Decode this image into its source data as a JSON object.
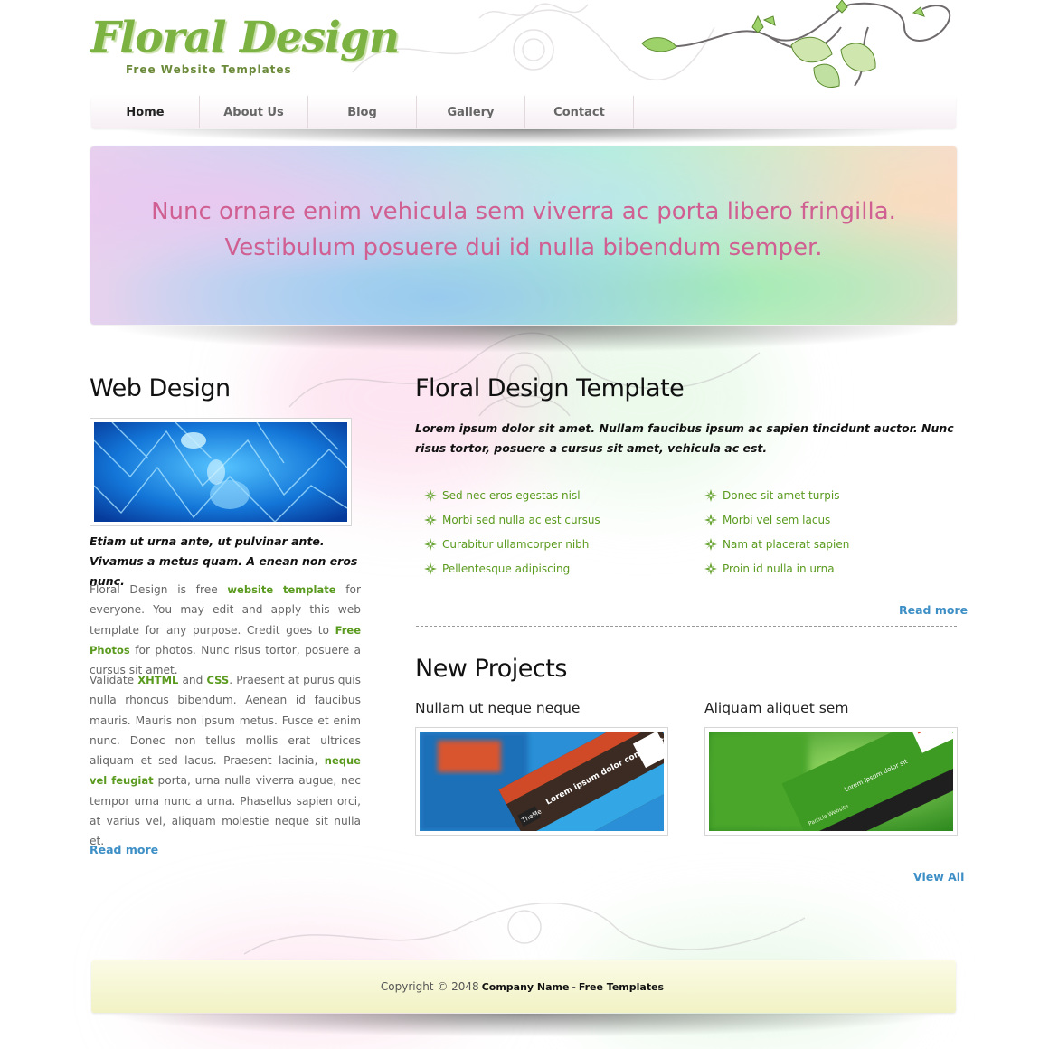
{
  "site": {
    "logo_title": "Floral Design",
    "logo_subtitle": "Free Website Templates"
  },
  "nav": {
    "items": [
      {
        "label": "Home",
        "active": true
      },
      {
        "label": "About Us"
      },
      {
        "label": "Blog"
      },
      {
        "label": "Gallery"
      },
      {
        "label": "Contact"
      }
    ]
  },
  "banner": {
    "line1": "Nunc ornare enim vehicula sem viverra ac porta libero fringilla.",
    "line2": "Vestibulum posuere dui id nulla bibendum semper."
  },
  "sidebar": {
    "heading": "Web Design",
    "lead": "Etiam ut urna ante, ut pulvinar ante. Vivamus a metus quam. A enean non eros nunc.",
    "p1_a": "Floral Design is free ",
    "p1_link1": "website template",
    "p1_b": " for everyone. You may edit and apply this web template for any purpose. Credit goes to ",
    "p1_link2": "Free Photos",
    "p1_c": " for photos. Nunc risus tortor, posuere a cursus sit amet.",
    "p2_a": "Validate ",
    "p2_link1": "XHTML",
    "p2_b": " and ",
    "p2_link2": "CSS",
    "p2_c": ". Praesent at purus quis nulla rhoncus bibendum. Aenean id faucibus mauris. Mauris non ipsum metus. Fusce et enim nunc. Donec non tellus mollis erat ultrices aliquam et sed lacus. Praesent lacinia, ",
    "p2_link3": "neque vel feugiat",
    "p2_d": " porta, urna nulla viverra augue, nec tempor urna nunc a urna. Phasellus sapien orci, at varius vel, aliquam molestie neque sit nulla et.",
    "read_more": "Read more"
  },
  "main": {
    "heading": "Floral Design Template",
    "lead": "Lorem ipsum dolor sit amet. Nullam faucibus ipsum ac sapien tincidunt auctor. Nunc risus tortor, posuere a cursus sit amet, vehicula ac est.",
    "list_left": [
      "Sed nec eros egestas nisl",
      "Morbi sed nulla ac est cursus",
      "Curabitur ullamcorper nibh",
      "Pellentesque adipiscing"
    ],
    "list_right": [
      "Donec sit amet turpis",
      "Morbi vel sem lacus",
      "Nam at placerat sapien",
      "Proin id nulla in urna"
    ],
    "read_more": "Read more"
  },
  "projects": {
    "heading": "New Projects",
    "items": [
      {
        "title": "Nullam ut neque neque",
        "thumb_text": "Lorem ipsum dolor consectetur adipi",
        "thumb_brand": "TheMe"
      },
      {
        "title": "Aliquam aliquet sem",
        "thumb_text": "Lorem ipsum dolor sit",
        "thumb_brand": "Particle Website"
      }
    ],
    "view_all": "View All"
  },
  "footer": {
    "copyright": "Copyright © 2048",
    "company": "Company Name",
    "dash": "-",
    "templates": "Free Templates"
  },
  "colors": {
    "brand_green": "#7bb241",
    "link_green": "#5a9a1e",
    "link_blue": "#3d8fc6",
    "banner_text": "#d05f92"
  }
}
